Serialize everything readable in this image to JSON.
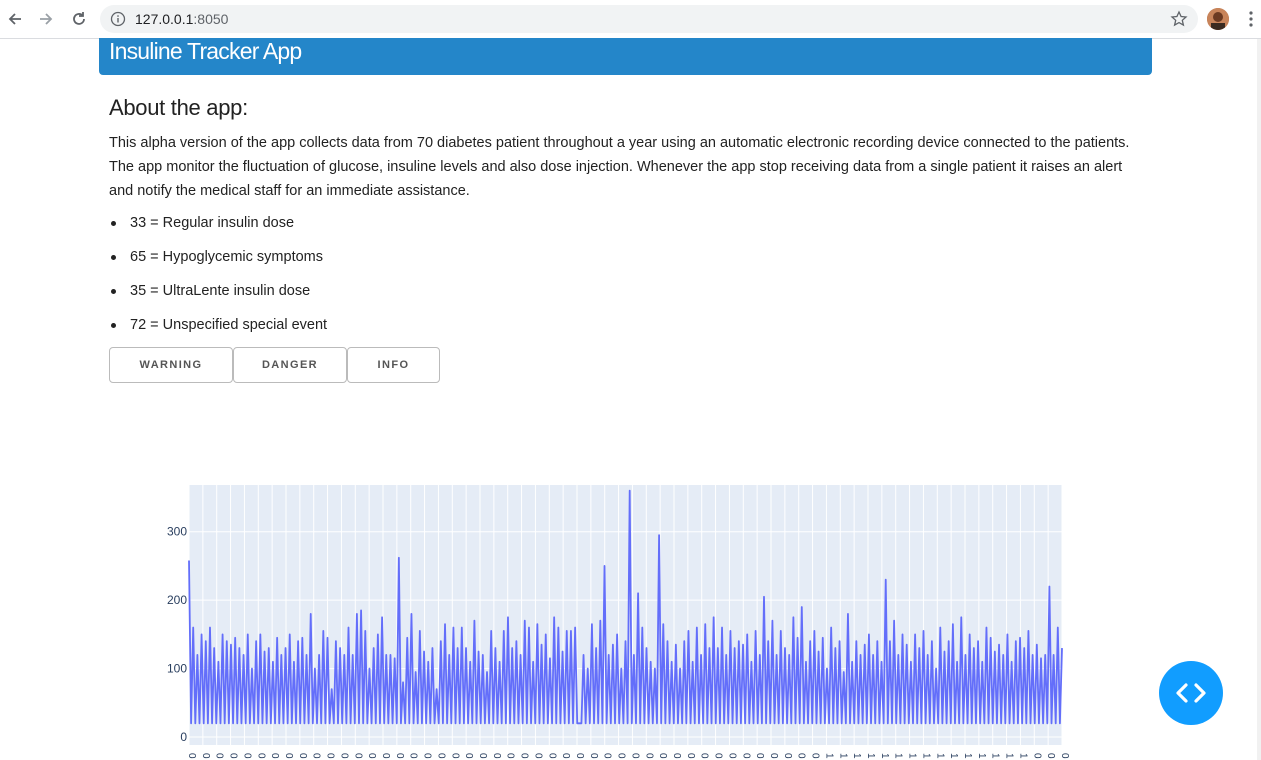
{
  "browser": {
    "url_host": "127.0.0.1",
    "url_port": ":8050",
    "icons": [
      "back-icon",
      "forward-icon",
      "reload-icon",
      "info-icon",
      "bookmark-star-icon",
      "menu-kebab-icon"
    ]
  },
  "header": {
    "title": "Insuline Tracker App",
    "color": "#2486c9"
  },
  "about": {
    "title": "About the app:",
    "text": "This alpha version of the app collects data from 70 diabetes patient throughout a year using an automatic electronic recording device connected to the patients. The app monitor the fluctuation of glucose, insuline levels and also dose injection. Whenever the app stop receiving data from a single patient it raises an alert and notify the medical staff for an immediate assistance.",
    "codes": [
      "33 = Regular insulin dose",
      "65 = Hypoglycemic symptoms",
      "35 = UltraLente insulin dose",
      "72 = Unspecified special event"
    ]
  },
  "buttons": {
    "warning": "WARNING",
    "danger": "DANGER",
    "info": "INFO"
  },
  "chart_data": {
    "type": "line",
    "title": "",
    "xlabel": "",
    "ylabel": "",
    "ylim": [
      0,
      380
    ],
    "yticks": [
      0,
      100,
      200,
      300
    ],
    "grid": true,
    "series_color": "#636efa",
    "x_tick_labels_visible": [
      "0",
      "0",
      "0",
      "0",
      "0",
      "0",
      "0",
      "0",
      "0",
      "0",
      "0",
      "0",
      "0",
      "0",
      "0",
      "0",
      "0",
      "0",
      "0",
      "0",
      "0",
      "0",
      "0",
      "0",
      "0",
      "0",
      "0",
      "0",
      "0",
      "0",
      "0",
      "0",
      "0",
      "0",
      "0",
      "0",
      "0",
      "0",
      "0",
      "0",
      "0",
      "0",
      "0",
      "0",
      "0",
      "0",
      "1",
      "1",
      "1",
      "1",
      "1",
      "1",
      "1",
      "1",
      "1",
      "1",
      "1",
      "1",
      "1",
      "1",
      "1",
      "0",
      "0",
      "0"
    ],
    "series": [
      {
        "values": [
          258,
          20,
          160,
          20,
          120,
          20,
          150,
          20,
          140,
          20,
          160,
          20,
          130,
          20,
          110,
          20,
          150,
          20,
          140,
          20,
          135,
          20,
          145,
          20,
          130,
          20,
          120,
          20,
          150,
          20,
          100,
          20,
          140,
          20,
          150,
          20,
          125,
          20,
          130,
          20,
          110,
          20,
          145,
          20,
          120,
          20,
          130,
          20,
          150,
          20,
          110,
          20,
          140,
          20,
          145,
          20,
          120,
          20,
          180,
          20,
          100,
          20,
          120,
          20,
          155,
          20,
          145,
          20,
          70,
          20,
          140,
          20,
          130,
          20,
          120,
          20,
          160,
          20,
          120,
          20,
          180,
          20,
          185,
          20,
          155,
          20,
          100,
          20,
          130,
          20,
          150,
          20,
          175,
          20,
          120,
          20,
          120,
          20,
          115,
          20,
          262,
          20,
          80,
          20,
          145,
          20,
          180,
          20,
          95,
          20,
          155,
          20,
          125,
          20,
          110,
          20,
          130,
          20,
          70,
          20,
          140,
          20,
          165,
          20,
          120,
          20,
          160,
          20,
          130,
          20,
          160,
          20,
          130,
          20,
          110,
          20,
          170,
          20,
          125,
          20,
          120,
          20,
          95,
          20,
          155,
          20,
          130,
          20,
          110,
          20,
          155,
          20,
          175,
          20,
          130,
          20,
          140,
          20,
          120,
          20,
          170,
          20,
          160,
          20,
          110,
          20,
          165,
          20,
          135,
          20,
          150,
          20,
          115,
          20,
          175,
          20,
          160,
          20,
          125,
          20,
          155,
          20,
          155,
          20,
          160,
          20,
          20,
          20,
          120,
          20,
          100,
          20,
          165,
          20,
          130,
          20,
          170,
          20,
          250,
          20,
          120,
          20,
          135,
          20,
          150,
          20,
          100,
          20,
          140,
          20,
          360,
          20,
          120,
          20,
          210,
          20,
          160,
          20,
          130,
          20,
          110,
          20,
          100,
          20,
          295,
          20,
          165,
          20,
          140,
          20,
          110,
          20,
          135,
          20,
          100,
          20,
          140,
          20,
          155,
          20,
          110,
          20,
          160,
          20,
          120,
          20,
          165,
          20,
          130,
          20,
          175,
          20,
          130,
          20,
          160,
          20,
          120,
          20,
          155,
          20,
          130,
          20,
          140,
          20,
          135,
          20,
          150,
          20,
          110,
          20,
          155,
          20,
          120,
          20,
          205,
          20,
          140,
          20,
          170,
          20,
          120,
          20,
          155,
          20,
          130,
          20,
          120,
          20,
          175,
          20,
          145,
          20,
          190,
          20,
          110,
          20,
          140,
          20,
          155,
          20,
          125,
          20,
          145,
          20,
          100,
          20,
          160,
          20,
          130,
          20,
          140,
          20,
          95,
          20,
          180,
          20,
          110,
          20,
          140,
          20,
          120,
          20,
          135,
          20,
          150,
          20,
          120,
          20,
          140,
          20,
          110,
          20,
          230,
          20,
          140,
          20,
          170,
          20,
          120,
          20,
          150,
          20,
          135,
          20,
          110,
          20,
          150,
          20,
          130,
          20,
          155,
          20,
          120,
          20,
          140,
          20,
          100,
          20,
          160,
          20,
          125,
          20,
          140,
          20,
          165,
          20,
          110,
          20,
          175,
          20,
          120,
          20,
          150,
          20,
          130,
          20,
          140,
          20,
          110,
          20,
          160,
          20,
          145,
          20,
          125,
          20,
          135,
          20,
          120,
          20,
          150,
          20,
          110,
          20,
          140,
          20,
          145,
          20,
          130,
          20,
          155,
          20,
          120,
          20,
          135,
          20,
          115,
          20,
          120,
          20,
          220,
          20,
          120,
          20,
          160,
          20,
          130
        ]
      }
    ]
  }
}
